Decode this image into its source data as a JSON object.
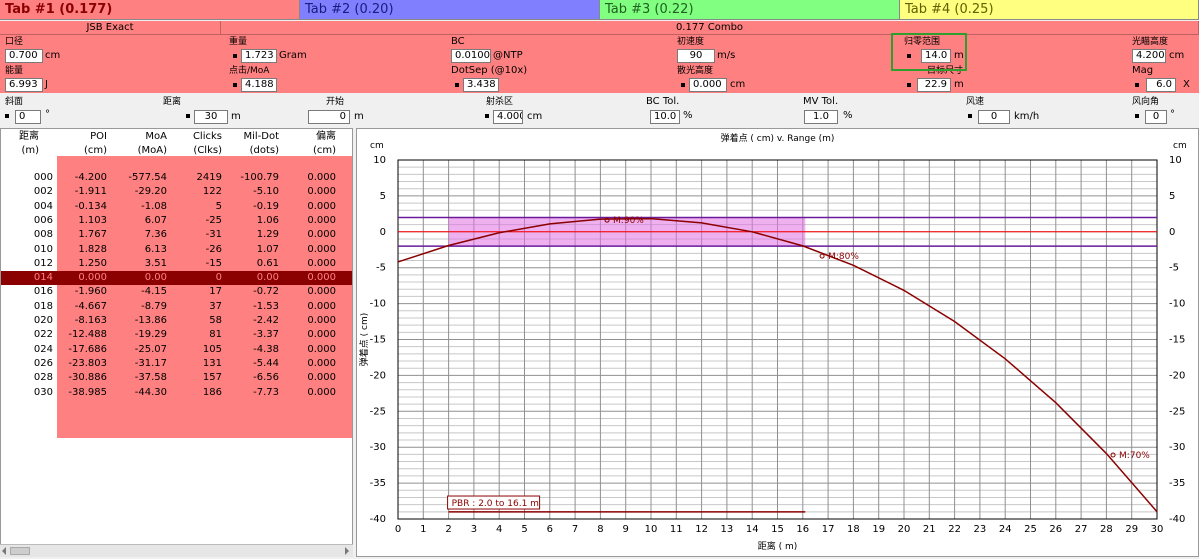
{
  "tabs": [
    {
      "label": "Tab #1 (0.177)",
      "color": "#ff8080",
      "text_color": "#8b0000"
    },
    {
      "label": "Tab #2 (0.20)",
      "color": "#8080ff",
      "text_color": "#1a1a80"
    },
    {
      "label": "Tab #3 (0.22)",
      "color": "#80ff80",
      "text_color": "#206020"
    },
    {
      "label": "Tab #4 (0.25)",
      "color": "#ffff80",
      "text_color": "#606000"
    }
  ],
  "header": {
    "left": "JSB Exact",
    "right": "0.177 Combo"
  },
  "params": {
    "caliber": {
      "label": "口径",
      "value": "0.700",
      "unit": "cm"
    },
    "weight": {
      "label": "重量",
      "value": "1.723",
      "unit": "Gram"
    },
    "bc": {
      "label": "BC",
      "value": "0.0100",
      "unit": "@NTP"
    },
    "velocity": {
      "label": "初速度",
      "value": "90",
      "unit": "m/s"
    },
    "zero_range": {
      "label": "归零范围",
      "value": "14.0",
      "unit": "m"
    },
    "scope_height": {
      "label": "光瞄高度",
      "value": "4.200",
      "unit": "cm"
    },
    "energy": {
      "label": "能量",
      "value": "6.993",
      "unit": "J"
    },
    "click_moa": {
      "label": "点击/MoA",
      "value": "4.188",
      "unit": ""
    },
    "dotsep": {
      "label": "DotSep (@10x)",
      "value": "3.438",
      "unit": ""
    },
    "scope_h2": {
      "label": "散光高度",
      "value": "0.000",
      "unit": "cm"
    },
    "target": {
      "label": "目标尺寸",
      "value": "22.9",
      "unit": "m"
    },
    "mag": {
      "label": "Mag",
      "value": "6.0",
      "unit": "X"
    },
    "slope": {
      "label": "斜面",
      "value": "0",
      "unit": "°"
    },
    "distance": {
      "label": "距离",
      "value": "30",
      "unit": "m"
    },
    "start": {
      "label": "开始",
      "value": "0",
      "unit": "m"
    },
    "kill_zone": {
      "label": "射杀区",
      "value": "4.000",
      "unit": "cm"
    },
    "bc_tol": {
      "label": "BC Tol.",
      "value": "10.0",
      "unit": "%"
    },
    "mv_tol": {
      "label": "MV Tol.",
      "value": "1.0",
      "unit": "%"
    },
    "wind": {
      "label": "风速",
      "value": "0",
      "unit": "km/h"
    },
    "wind_angle": {
      "label": "风向角",
      "value": "0",
      "unit": "°"
    }
  },
  "table": {
    "headers": [
      {
        "top": "距离",
        "sub": "(m)"
      },
      {
        "top": "POI",
        "sub": "(cm)"
      },
      {
        "top": "MoA",
        "sub": "(MoA)"
      },
      {
        "top": "Clicks",
        "sub": "(Clks)"
      },
      {
        "top": "Mil-Dot",
        "sub": "(dots)"
      },
      {
        "top": "偏离",
        "sub": "(cm)"
      }
    ],
    "rows": [
      [
        "000",
        "-4.200",
        "-577.54",
        "2419",
        "-100.79",
        "0.000"
      ],
      [
        "002",
        "-1.911",
        "-29.20",
        "122",
        "-5.10",
        "0.000"
      ],
      [
        "004",
        "-0.134",
        "-1.08",
        "5",
        "-0.19",
        "0.000"
      ],
      [
        "006",
        "1.103",
        "6.07",
        "-25",
        "1.06",
        "0.000"
      ],
      [
        "008",
        "1.767",
        "7.36",
        "-31",
        "1.29",
        "0.000"
      ],
      [
        "010",
        "1.828",
        "6.13",
        "-26",
        "1.07",
        "0.000"
      ],
      [
        "012",
        "1.250",
        "3.51",
        "-15",
        "0.61",
        "0.000"
      ],
      [
        "014",
        "0.000",
        "0.00",
        "0",
        "0.00",
        "0.000"
      ],
      [
        "016",
        "-1.960",
        "-4.15",
        "17",
        "-0.72",
        "0.000"
      ],
      [
        "018",
        "-4.667",
        "-8.79",
        "37",
        "-1.53",
        "0.000"
      ],
      [
        "020",
        "-8.163",
        "-13.86",
        "58",
        "-2.42",
        "0.000"
      ],
      [
        "022",
        "-12.488",
        "-19.29",
        "81",
        "-3.37",
        "0.000"
      ],
      [
        "024",
        "-17.686",
        "-25.07",
        "105",
        "-4.38",
        "0.000"
      ],
      [
        "026",
        "-23.803",
        "-31.17",
        "131",
        "-5.44",
        "0.000"
      ],
      [
        "028",
        "-30.886",
        "-37.58",
        "157",
        "-6.56",
        "0.000"
      ],
      [
        "030",
        "-38.985",
        "-44.30",
        "186",
        "-7.73",
        "0.000"
      ]
    ],
    "selected_index": 7
  },
  "chart_data": {
    "type": "line",
    "title": "弹着点 ( cm) v. Range (m)",
    "xlabel": "距离 ( m)",
    "ylabel": "弹着点 ( cm)",
    "y_unit_left": "cm",
    "y_unit_right": "cm",
    "xlim": [
      0,
      30
    ],
    "ylim": [
      -40,
      10
    ],
    "xticks": [
      0,
      1,
      2,
      3,
      4,
      5,
      6,
      7,
      8,
      9,
      10,
      11,
      12,
      13,
      14,
      15,
      16,
      17,
      18,
      19,
      20,
      21,
      22,
      23,
      24,
      25,
      26,
      27,
      28,
      29,
      30
    ],
    "yticks": [
      10,
      5,
      0,
      -5,
      -10,
      -15,
      -20,
      -25,
      -30,
      -35,
      -40
    ],
    "grid": true,
    "series": [
      {
        "x": [
          0,
          2,
          4,
          6,
          8,
          10,
          12,
          14,
          16,
          18,
          20,
          22,
          24,
          26,
          28,
          30
        ],
        "y": [
          -4.2,
          -1.911,
          -0.134,
          1.103,
          1.767,
          1.828,
          1.25,
          0,
          -1.96,
          -4.667,
          -8.163,
          -12.488,
          -17.686,
          -23.803,
          -30.886,
          -38.985
        ]
      }
    ],
    "kill_zone": {
      "x_from": 2.0,
      "x_to": 16.1,
      "y_from": -2,
      "y_to": 2
    },
    "hlines": [
      2,
      -2,
      0
    ],
    "annotations": [
      "M:90%",
      "M:80%",
      "M:70%"
    ],
    "pbr_label": "PBR : 2.0 to 16.1 m",
    "colors": {
      "curve": "#8b0000",
      "band": "#e070e0",
      "zone_line": "#6a1a9a",
      "zero_line": "#ff0000"
    }
  }
}
